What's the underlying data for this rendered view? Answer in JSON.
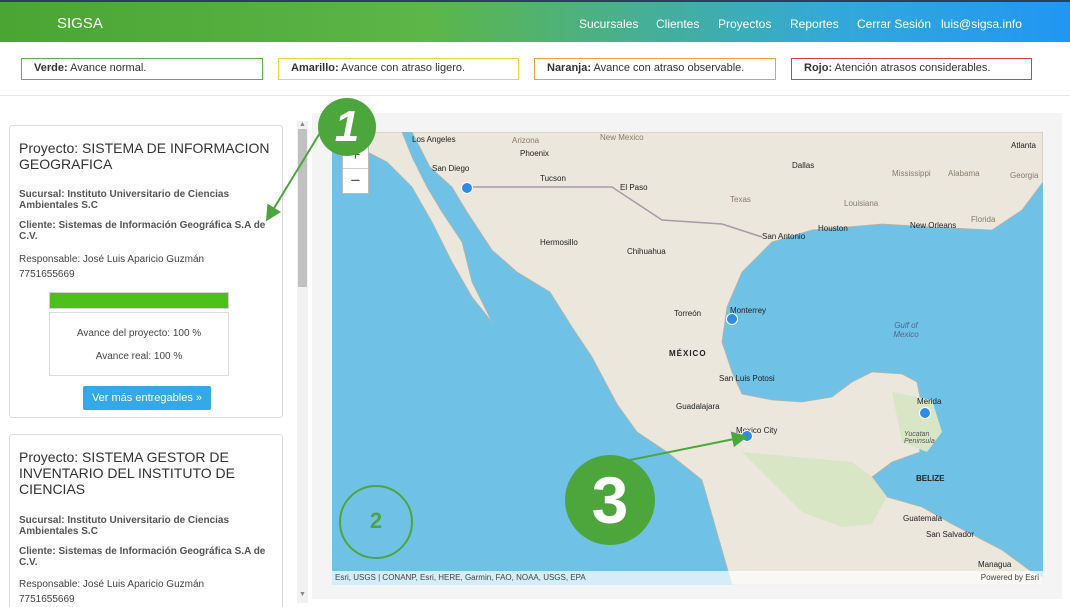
{
  "header": {
    "brand": "SIGSA",
    "nav": [
      "Sucursales",
      "Clientes",
      "Proyectos",
      "Reportes",
      "Cerrar Sesión",
      "luis@sigsa.info"
    ]
  },
  "legend": [
    {
      "label": "Verde:",
      "text": " Avance normal.",
      "color": "#57b840"
    },
    {
      "label": "Amarillo:",
      "text": " Avance con atraso ligero.",
      "color": "#f5d336"
    },
    {
      "label": "Naranja:",
      "text": " Avance con atraso observable.",
      "color": "#f0a23a"
    },
    {
      "label": "Rojo:",
      "text": " Atención atrasos considerables.",
      "color": "#d9403a"
    }
  ],
  "projects": [
    {
      "title": "Proyecto: SISTEMA DE INFORMACION GEOGRAFICA",
      "sucursal": "Sucursal: Instituto Universitario de Ciencias Ambientales S.C",
      "cliente": "Cliente: Sistemas de Información Geográfica S.A de C.V.",
      "responsable": "Responsable: José Luis Aparicio Guzmán",
      "phone": "7751655669",
      "progress": 100,
      "bar_color": "#4cc119",
      "avance_proyecto": "Avance del proyecto: 100 %",
      "avance_real": "Avance real: 100 %",
      "button": "Ver más entregables »"
    },
    {
      "title": "Proyecto: SISTEMA GESTOR DE INVENTARIO DEL INSTITUTO DE CIENCIAS",
      "sucursal": "Sucursal: Instituto Universitario de Ciencias Ambientales S.C",
      "cliente": "Cliente: Sistemas de Información Geográfica S.A de C.V.",
      "responsable": "Responsable: José Luis Aparicio Guzmán",
      "phone": "7751655669"
    }
  ],
  "map": {
    "zoom_in": "+",
    "zoom_out": "−",
    "attribution": "Esri, USGS | CONANP, Esri, HERE, Garmin, FAO, NOAA, USGS, EPA",
    "powered_by": "Powered by Esri",
    "labels": [
      "Los Angeles",
      "Arizona",
      "New Mexico",
      "Phoenix",
      "San Diego",
      "Tucson",
      "El Paso",
      "Dallas",
      "Mississippi",
      "Alabama",
      "Atlanta",
      "Georgia",
      "Texas",
      "Louisiana",
      "Florida",
      "Houston",
      "New Orleans",
      "San Antonio",
      "Hermosillo",
      "Chihuahua",
      "Monterrey",
      "Torreón",
      "MÉXICO",
      "Gulf of Mexico",
      "San Luis Potosi",
      "Guadalajara",
      "Mexico City",
      "Merida",
      "Yucatan Peninsula",
      "BELIZE",
      "Guatemala",
      "San Salvador",
      "Managua"
    ],
    "marker_color": "#2f8be8"
  },
  "callouts": [
    "1",
    "2",
    "3"
  ],
  "callout_color": "#4ca63c"
}
